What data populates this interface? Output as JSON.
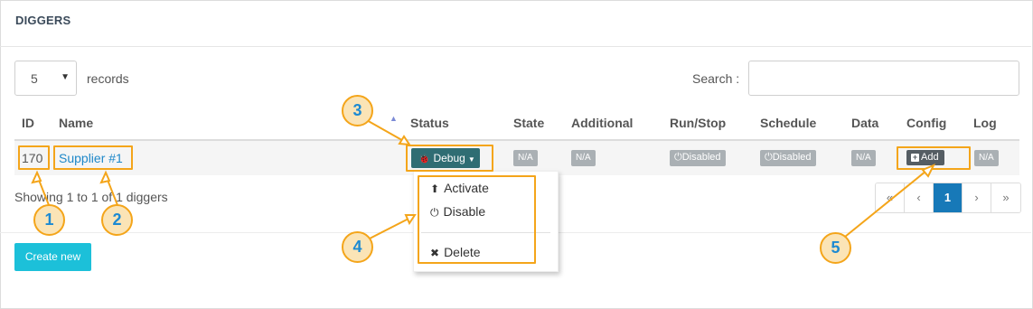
{
  "panel": {
    "title": "DIGGERS"
  },
  "controls": {
    "length_value": "5",
    "records_label": "records",
    "search_label": "Search :",
    "search_value": ""
  },
  "table": {
    "columns": [
      "ID",
      "Name",
      "Status",
      "State",
      "Additional",
      "Run/Stop",
      "Schedule",
      "Data",
      "Config",
      "Log"
    ],
    "row": {
      "id": "170",
      "name": "Supplier #1",
      "status_button": "Debug",
      "state": "N/A",
      "additional": "N/A",
      "run_stop": "Disabled",
      "schedule": "Disabled",
      "data": "N/A",
      "config_button": "Add",
      "log": "N/A"
    }
  },
  "status_menu": {
    "items": [
      "Activate",
      "Disable",
      "Delete"
    ]
  },
  "info": "Showing 1 to 1 of 1 diggers",
  "pagination": [
    "«",
    "‹",
    "1",
    "›",
    "»"
  ],
  "create_button": "Create new",
  "callouts": [
    "1",
    "2",
    "3",
    "4",
    "5"
  ],
  "colors": {
    "highlight": "#f4a51a",
    "callout_fill": "#fbe4b6",
    "callout_text": "#1d8ad2",
    "debug_button": "#2f6d73",
    "create_button": "#1cc0d9",
    "active_page": "#1779b8",
    "link": "#1e88c9"
  }
}
